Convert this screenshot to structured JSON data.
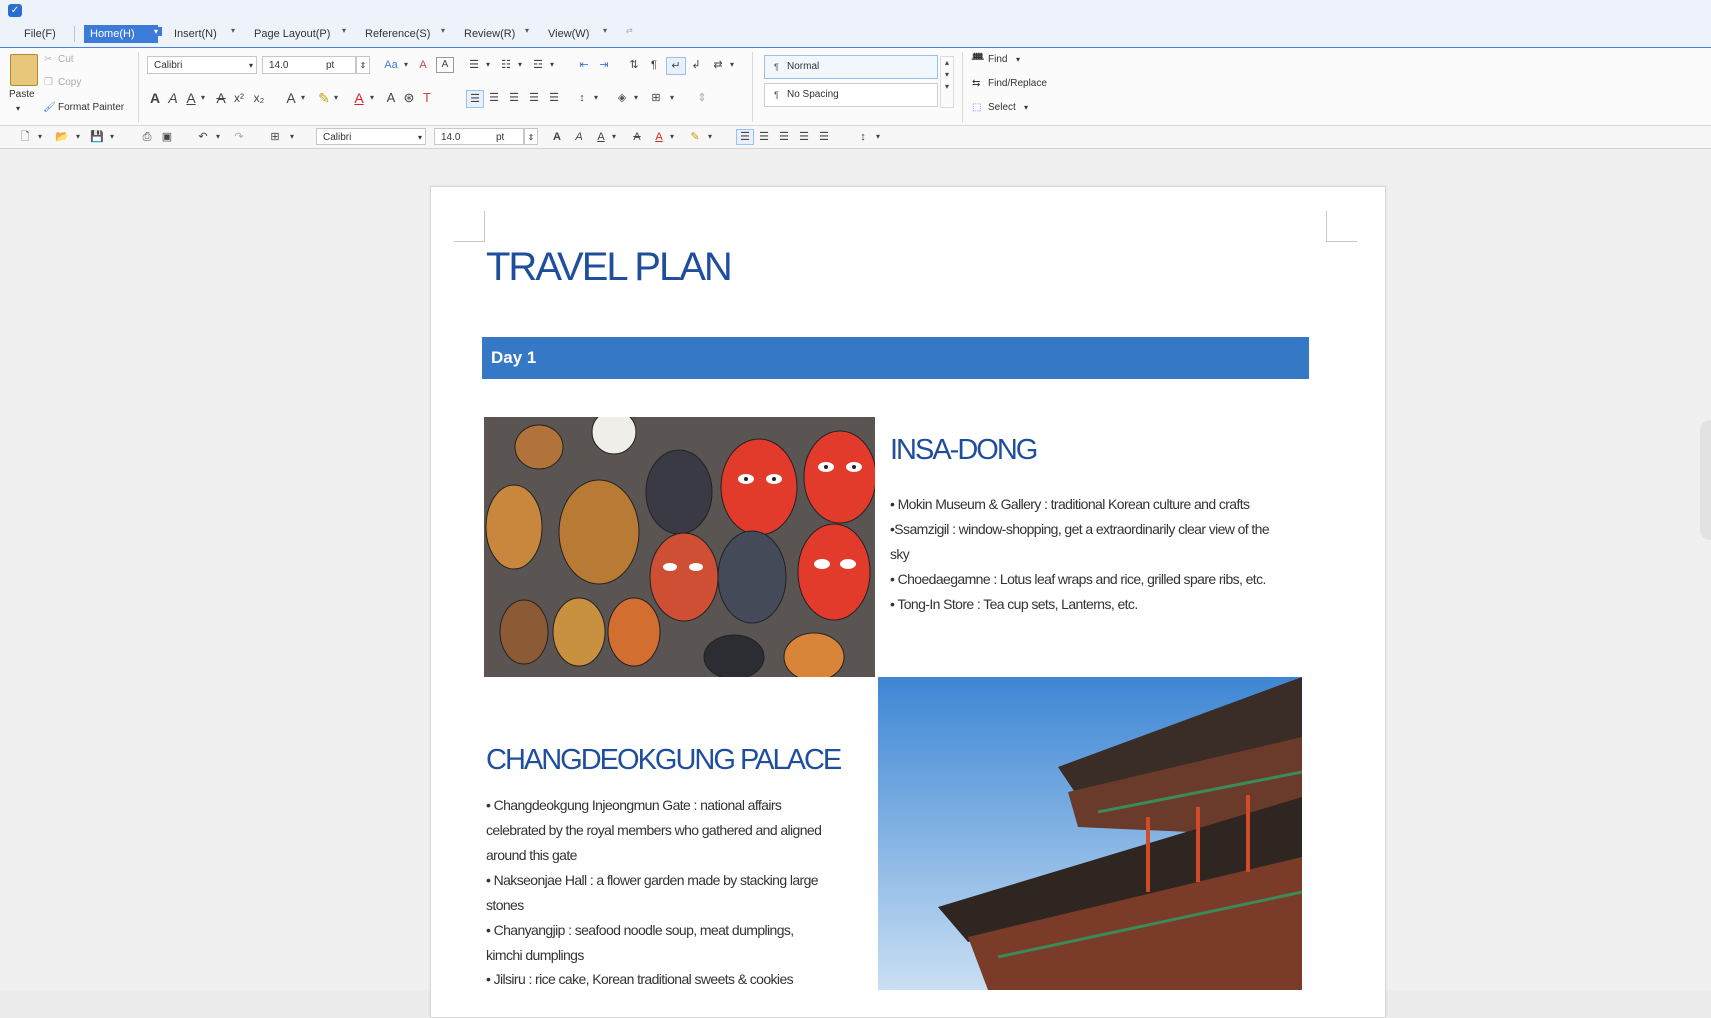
{
  "menubar": {
    "file": "File(F)",
    "home": "Home(H)",
    "insert": "Insert(N)",
    "page_layout": "Page Layout(P)",
    "reference": "Reference(S)",
    "review": "Review(R)",
    "view": "View(W)"
  },
  "ribbon": {
    "paste": "Paste",
    "cut": "Cut",
    "copy": "Copy",
    "format_painter": "Format Painter",
    "font_name": "Calibri",
    "font_size": "14.0",
    "font_unit": "pt",
    "style_normal": "Normal",
    "style_no_spacing": "No Spacing",
    "find": "Find",
    "find_replace": "Find/Replace",
    "select": "Select"
  },
  "qat": {
    "font_name": "Calibri",
    "font_size": "14.0",
    "font_unit": "pt"
  },
  "document": {
    "title": "TRAVEL PLAN",
    "day_label": "Day 1",
    "insa": {
      "title": "INSA-DONG",
      "bullets": [
        "• Mokin Museum & Gallery : traditional Korean culture and crafts",
        "•Ssamzigil : window-shopping, get a extraordinarily clear view of the",
        "sky",
        "• Choedaegamne : Lotus leaf wraps and rice, grilled spare ribs, etc.",
        "• Tong-In Store : Tea cup sets, Lanterns, etc."
      ]
    },
    "palace": {
      "title": "CHANGDEOKGUNG PALACE",
      "bullets": [
        "• Changdeokgung Injeongmun Gate : national affairs",
        "celebrated by the royal members who gathered and aligned",
        "around this gate",
        "• Nakseonjae Hall :  a flower garden made by stacking large",
        "stones",
        "• Chanyangjip : seafood noodle soup, meat dumplings,",
        "kimchi dumplings",
        "• Jilsiru : rice cake, Korean traditional sweets & cookies"
      ]
    }
  },
  "colors": {
    "accent": "#3d7bd9",
    "title_blue": "#1f4e9c",
    "day_bar": "#3478c6"
  }
}
